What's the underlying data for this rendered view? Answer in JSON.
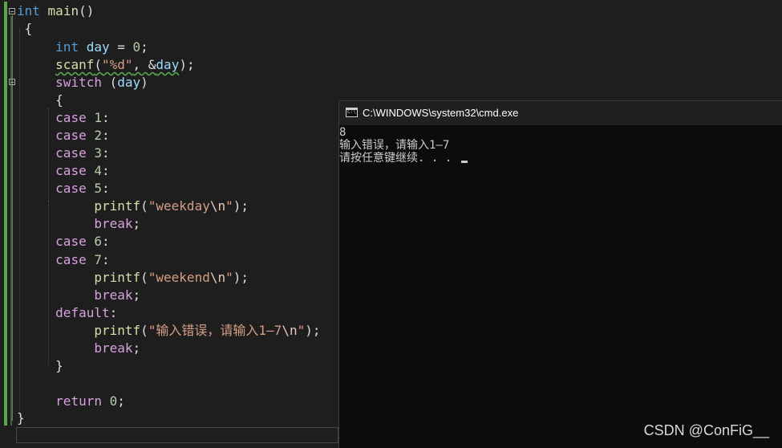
{
  "editor": {
    "line0": {
      "kw": "int",
      "fn": "main",
      "rest": "()"
    },
    "line1": {
      "text": "{"
    },
    "line2": {
      "kw": "int",
      "var": "day",
      "op": " = ",
      "num": "0",
      "end": ";"
    },
    "line3": {
      "fn": "scanf",
      "open": "(",
      "fmt": "\"%d\"",
      "sep": ", &",
      "var": "day",
      "close": ");"
    },
    "line4": {
      "ctl": "switch",
      "open": " (",
      "var": "day",
      "close": ")"
    },
    "line5": {
      "text": "{"
    },
    "case1": {
      "ctl": "case",
      "num": "1",
      "colon": ":"
    },
    "case2": {
      "ctl": "case",
      "num": "2",
      "colon": ":"
    },
    "case3": {
      "ctl": "case",
      "num": "3",
      "colon": ":"
    },
    "case4": {
      "ctl": "case",
      "num": "4",
      "colon": ":"
    },
    "case5": {
      "ctl": "case",
      "num": "5",
      "colon": ":"
    },
    "printf1": {
      "fn": "printf",
      "open": "(",
      "str": "\"weekday",
      "esc": "\\n",
      "strend": "\"",
      "close": ");"
    },
    "break1": {
      "ctl": "break",
      "end": ";"
    },
    "case6": {
      "ctl": "case",
      "num": "6",
      "colon": ":"
    },
    "case7": {
      "ctl": "case",
      "num": "7",
      "colon": ":"
    },
    "printf2": {
      "fn": "printf",
      "open": "(",
      "str": "\"weekend",
      "esc": "\\n",
      "strend": "\"",
      "close": ");"
    },
    "break2": {
      "ctl": "break",
      "end": ";"
    },
    "default": {
      "ctl": "default",
      "colon": ":"
    },
    "printf3": {
      "fn": "printf",
      "open": "(",
      "str": "\"输入错误，请输入1—7",
      "esc": "\\n",
      "strend": "\"",
      "close": ");"
    },
    "break3": {
      "ctl": "break",
      "end": ";"
    },
    "close_switch": {
      "text": "}"
    },
    "ret": {
      "ctl": "return",
      "num": "0",
      "end": ";"
    },
    "close_main": {
      "text": "}"
    }
  },
  "console": {
    "title": "C:\\WINDOWS\\system32\\cmd.exe",
    "output": [
      "8",
      "输入错误，请输入1—7",
      "请按任意键继续. . . "
    ]
  },
  "watermark": "CSDN @ConFiG__",
  "colors": {
    "editor_bg": "#1e1e1e",
    "keyword": "#569cd6",
    "control": "#d8a0df",
    "function": "#dcdcaa",
    "variable": "#9cdcfe",
    "string": "#d69d85",
    "change_bar": "#57a64a",
    "console_bg": "#0c0c0c",
    "titlebar_bg": "#202020"
  }
}
